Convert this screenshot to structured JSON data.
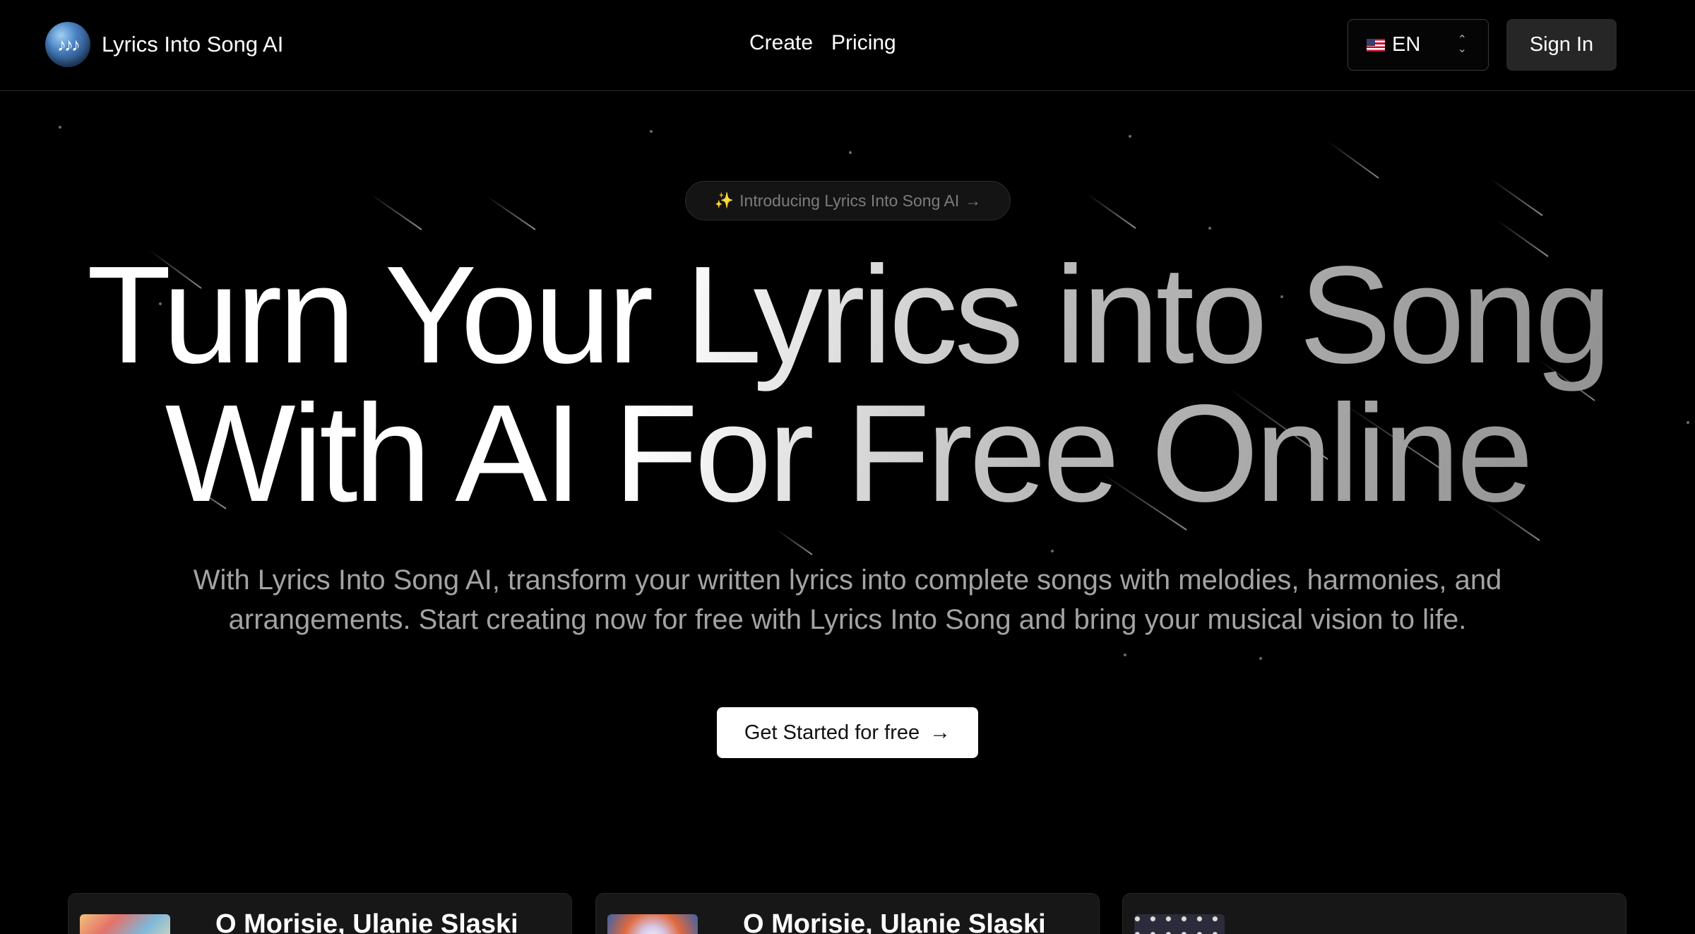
{
  "header": {
    "brand_name": "Lyrics Into Song AI",
    "logo_icon": "music-notes-globe",
    "nav": [
      {
        "label": "Create"
      },
      {
        "label": "Pricing"
      }
    ],
    "language": {
      "flag": "us-flag",
      "label": "EN"
    },
    "signin_label": "Sign In"
  },
  "hero": {
    "announcement": "Introducing Lyrics Into Song AI",
    "headline_line1": "Turn Your Lyrics into Song",
    "headline_line2": "With AI For Free Online",
    "subtext": "With Lyrics Into Song AI, transform your written lyrics into complete songs with melodies, harmonies, and arrangements. Start creating now for free with Lyrics Into Song and bring your musical vision to life.",
    "cta_label": "Get Started for free"
  },
  "cards": [
    {
      "title": "O Morisie, Ulanie Slaski"
    },
    {
      "title": "O Morisie, Ulanie Slaski"
    },
    {
      "title": ""
    }
  ],
  "colors": {
    "background": "#000000",
    "header_border": "#2a2a2a",
    "subtext": "#a3a3a3",
    "pill_bg": "#141414",
    "cta_bg": "#ffffff",
    "signin_bg": "#262626",
    "card_bg": "#171717"
  }
}
